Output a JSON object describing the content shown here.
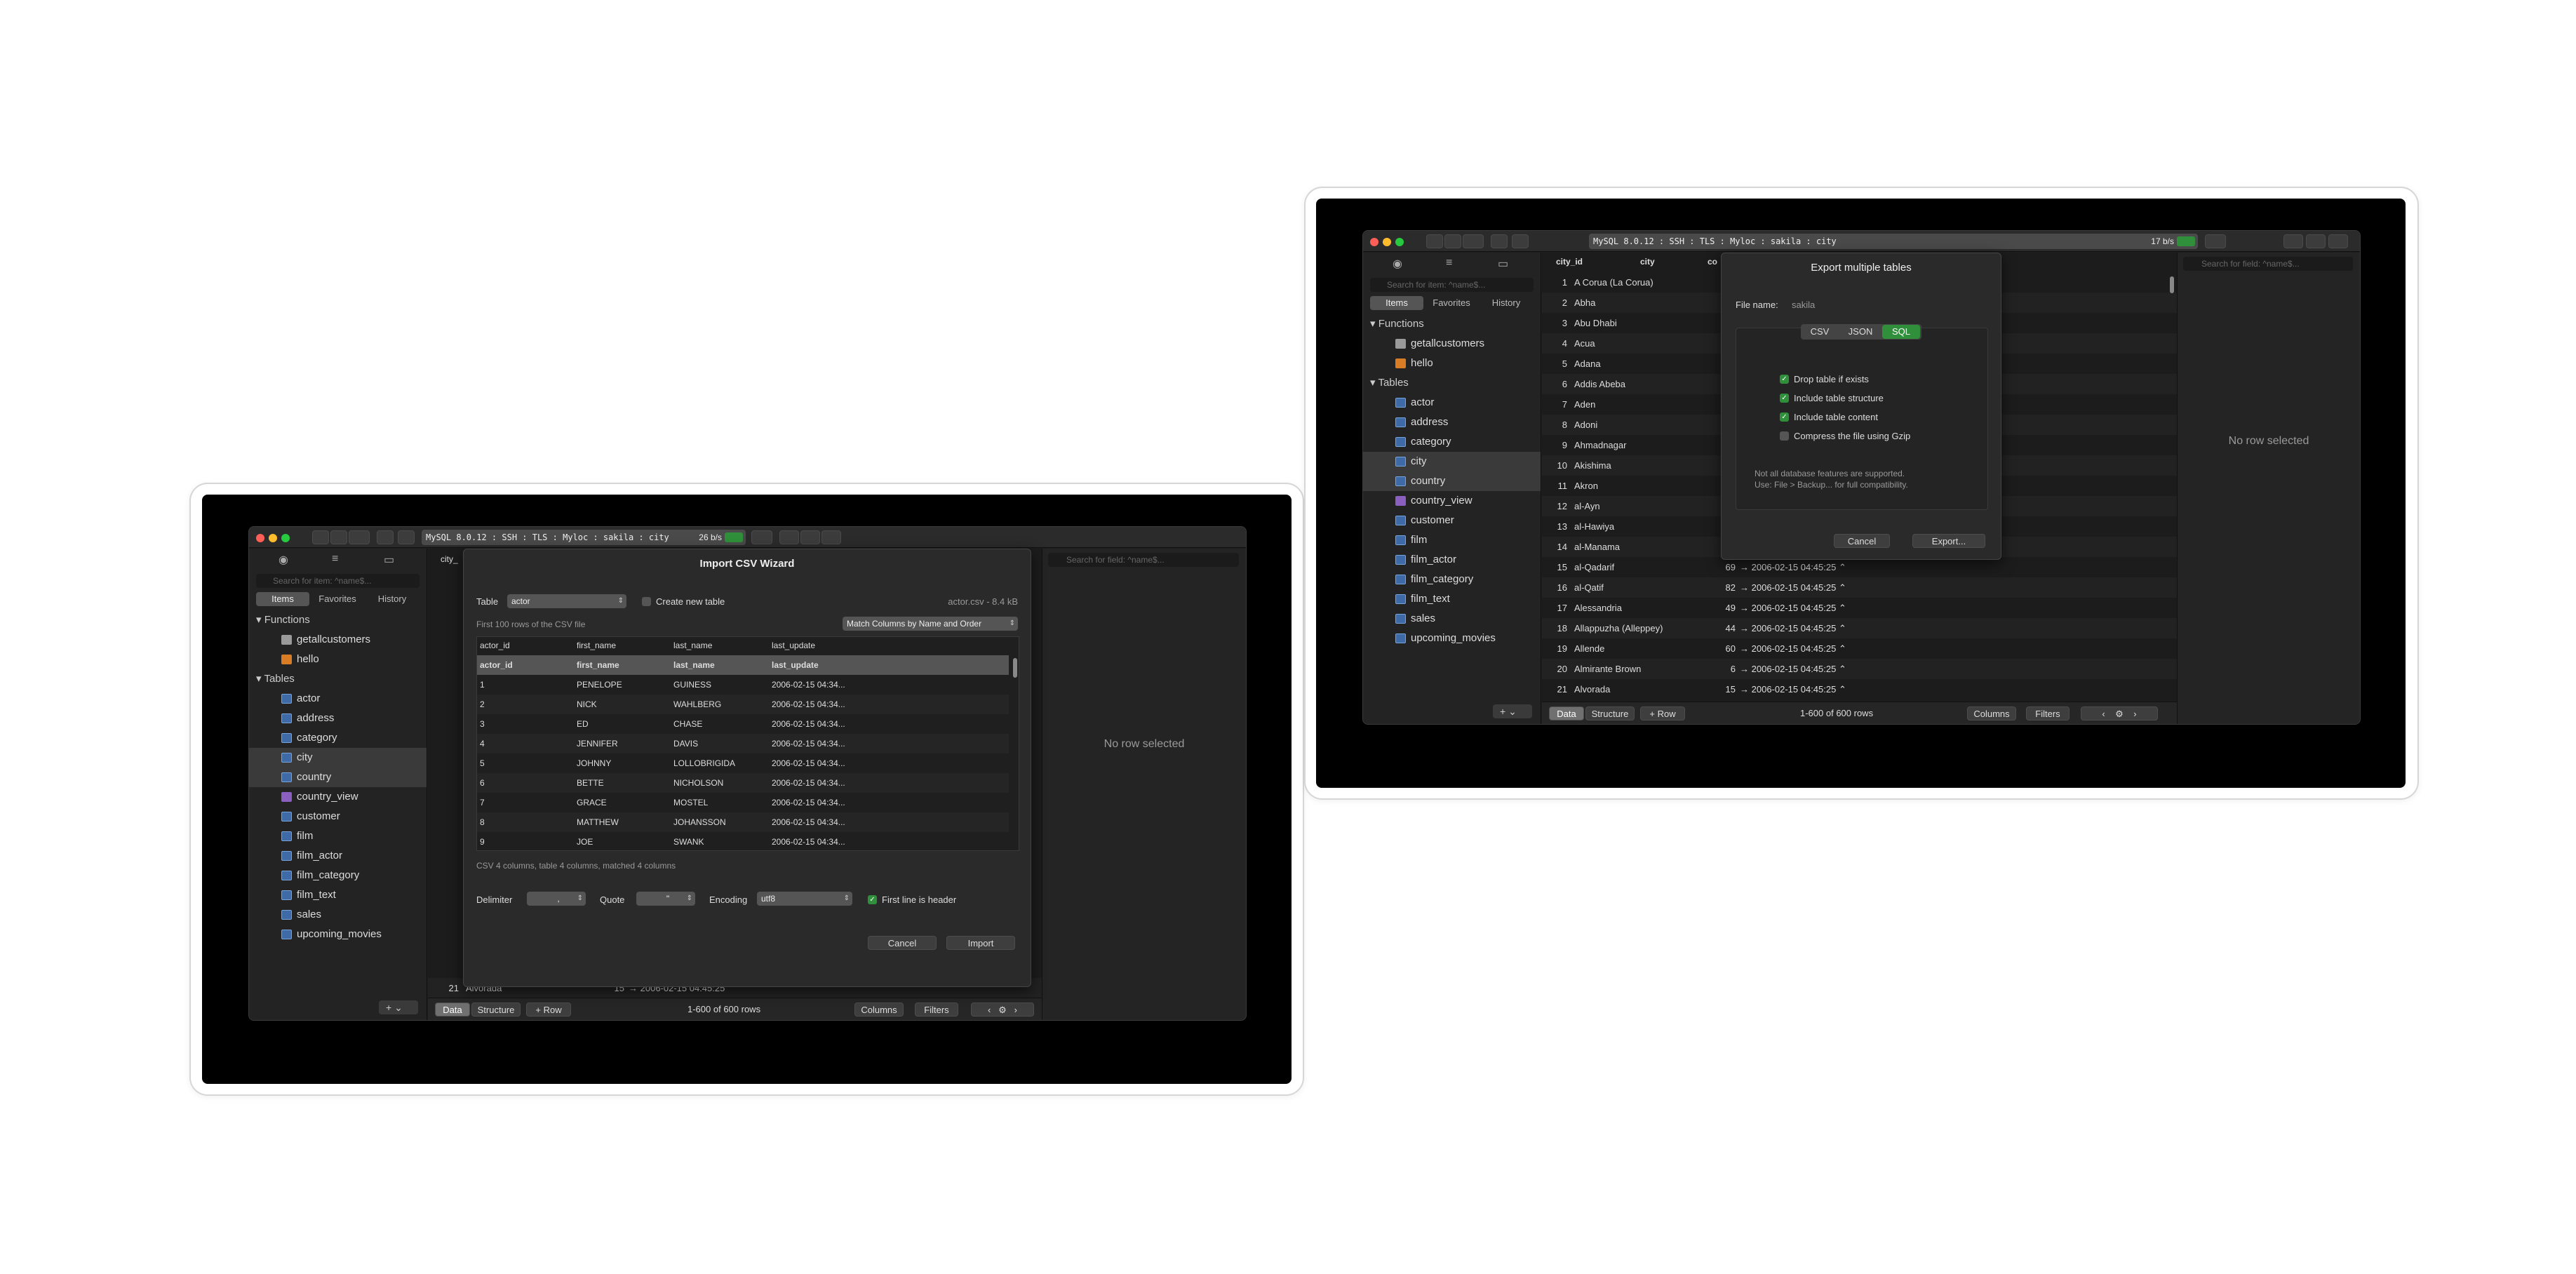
{
  "window": {
    "address": "MySQL 8.0.12 : SSH : TLS : Myloc : sakila : city"
  },
  "left_window": {
    "rate": "26 b/s"
  },
  "right_window": {
    "rate": "17 b/s"
  },
  "sidebar": {
    "search_placeholder": "Search for item: ^name$...",
    "tabs": [
      "Items",
      "Favorites",
      "History"
    ],
    "functions_header": "Functions",
    "functions": [
      "getallcustomers",
      "hello"
    ],
    "tables_header": "Tables",
    "tables": [
      "actor",
      "address",
      "category",
      "city",
      "country",
      "country_view",
      "customer",
      "film",
      "film_actor",
      "film_category",
      "film_text",
      "sales",
      "upcoming_movies"
    ]
  },
  "grid": {
    "columns": [
      "city_id",
      "city",
      "co"
    ],
    "left_col_stub": "city_",
    "rows": [
      {
        "id": "1",
        "city": "A Corua (La Corua)"
      },
      {
        "id": "2",
        "city": "Abha"
      },
      {
        "id": "3",
        "city": "Abu Dhabi"
      },
      {
        "id": "4",
        "city": "Acua"
      },
      {
        "id": "5",
        "city": "Adana"
      },
      {
        "id": "6",
        "city": "Addis Abeba"
      },
      {
        "id": "7",
        "city": "Aden"
      },
      {
        "id": "8",
        "city": "Adoni"
      },
      {
        "id": "9",
        "city": "Ahmadnagar"
      },
      {
        "id": "10",
        "city": "Akishima"
      },
      {
        "id": "11",
        "city": "Akron"
      },
      {
        "id": "12",
        "city": "al-Ayn"
      },
      {
        "id": "13",
        "city": "al-Hawiya"
      },
      {
        "id": "14",
        "city": "al-Manama"
      },
      {
        "id": "15",
        "city": "al-Qadarif",
        "country": "69",
        "date": "2006-02-15 04:45:25"
      },
      {
        "id": "16",
        "city": "al-Qatif",
        "country": "82",
        "date": "2006-02-15 04:45:25"
      },
      {
        "id": "17",
        "city": "Alessandria",
        "country": "49",
        "date": "2006-02-15 04:45:25"
      },
      {
        "id": "18",
        "city": "Allappuzha (Alleppey)",
        "country": "44",
        "date": "2006-02-15 04:45:25"
      },
      {
        "id": "19",
        "city": "Allende",
        "country": "60",
        "date": "2006-02-15 04:45:25"
      },
      {
        "id": "20",
        "city": "Almirante Brown",
        "country": "6",
        "date": "2006-02-15 04:45:25"
      },
      {
        "id": "21",
        "city": "Alvorada",
        "country": "15",
        "date": "2006-02-15 04:45:25"
      }
    ],
    "left_last_row": {
      "id": "21",
      "city": "Alvorada",
      "country": "15",
      "date": "2006-02-15 04:45:25"
    }
  },
  "bottom_bar": {
    "data": "Data",
    "structure": "Structure",
    "add_row": "+ Row",
    "count": "1-600 of 600 rows",
    "columns": "Columns",
    "filters": "Filters"
  },
  "right_pane": {
    "search_placeholder": "Search for field: ^name$...",
    "empty": "No row selected"
  },
  "export_dialog": {
    "title": "Export multiple tables",
    "file_label": "File name:",
    "file_value": "sakila",
    "formats": [
      "CSV",
      "JSON",
      "SQL"
    ],
    "selected_format": "SQL",
    "options": [
      {
        "label": "Drop table if exists",
        "checked": true
      },
      {
        "label": "Include table structure",
        "checked": true
      },
      {
        "label": "Include table content",
        "checked": true
      },
      {
        "label": "Compress the file using Gzip",
        "checked": false
      }
    ],
    "note1": "Not all database features are supported.",
    "note2": "Use: File > Backup... for full compatibility.",
    "cancel": "Cancel",
    "export": "Export..."
  },
  "import_dialog": {
    "title": "Import CSV Wizard",
    "table_label": "Table",
    "table_value": "actor",
    "create_new": "Create new table",
    "file_info": "actor.csv - 8.4 kB",
    "preview_note": "First 100 rows of the CSV file",
    "match_mode": "Match Columns by Name and Order",
    "columns": [
      "actor_id",
      "first_name",
      "last_name",
      "last_update"
    ],
    "rows": [
      [
        "actor_id",
        "first_name",
        "last_name",
        "last_update"
      ],
      [
        "1",
        "PENELOPE",
        "GUINESS",
        "2006-02-15 04:34..."
      ],
      [
        "2",
        "NICK",
        "WAHLBERG",
        "2006-02-15 04:34..."
      ],
      [
        "3",
        "ED",
        "CHASE",
        "2006-02-15 04:34..."
      ],
      [
        "4",
        "JENNIFER",
        "DAVIS",
        "2006-02-15 04:34..."
      ],
      [
        "5",
        "JOHNNY",
        "LOLLOBRIGIDA",
        "2006-02-15 04:34..."
      ],
      [
        "6",
        "BETTE",
        "NICHOLSON",
        "2006-02-15 04:34..."
      ],
      [
        "7",
        "GRACE",
        "MOSTEL",
        "2006-02-15 04:34..."
      ],
      [
        "8",
        "MATTHEW",
        "JOHANSSON",
        "2006-02-15 04:34..."
      ],
      [
        "9",
        "JOE",
        "SWANK",
        "2006-02-15 04:34..."
      ]
    ],
    "summary": "CSV 4 columns, table 4 columns, matched 4 columns",
    "delimiter_label": "Delimiter",
    "delimiter_value": ",",
    "quote_label": "Quote",
    "quote_value": "\"",
    "encoding_label": "Encoding",
    "encoding_value": "utf8",
    "first_line_header": "First line is header",
    "cancel": "Cancel",
    "import": "Import"
  },
  "colors": {
    "accent_green": "#2f8f3a",
    "table_icon": "#3e6aa8",
    "view_icon": "#8b5fbf"
  }
}
